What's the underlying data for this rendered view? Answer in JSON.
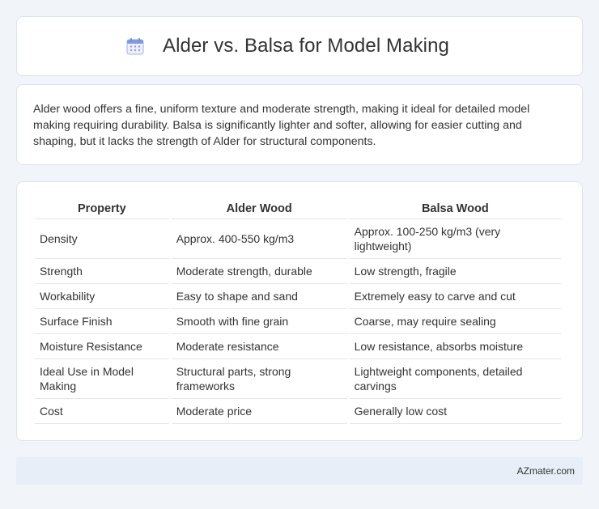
{
  "header": {
    "icon": "calendar-icon",
    "title": "Alder vs. Balsa for Model Making"
  },
  "intro": {
    "text": "Alder wood offers a fine, uniform texture and moderate strength, making it ideal for detailed model making requiring durability. Balsa is significantly lighter and softer, allowing for easier cutting and shaping, but it lacks the strength of Alder for structural components."
  },
  "table": {
    "headers": [
      "Property",
      "Alder Wood",
      "Balsa Wood"
    ],
    "rows": [
      [
        "Density",
        "Approx. 400-550 kg/m3",
        "Approx. 100-250 kg/m3 (very lightweight)"
      ],
      [
        "Strength",
        "Moderate strength, durable",
        "Low strength, fragile"
      ],
      [
        "Workability",
        "Easy to shape and sand",
        "Extremely easy to carve and cut"
      ],
      [
        "Surface Finish",
        "Smooth with fine grain",
        "Coarse, may require sealing"
      ],
      [
        "Moisture Resistance",
        "Moderate resistance",
        "Low resistance, absorbs moisture"
      ],
      [
        "Ideal Use in Model Making",
        "Structural parts, strong frameworks",
        "Lightweight components, detailed carvings"
      ],
      [
        "Cost",
        "Moderate price",
        "Generally low cost"
      ]
    ]
  },
  "footer": {
    "text": "AZmater.com"
  },
  "colors": {
    "background": "#f1f4f9",
    "card": "#ffffff",
    "footer_bg": "#e8eef8",
    "icon_blue": "#6a8fd8",
    "icon_purple": "#b58ad6"
  }
}
